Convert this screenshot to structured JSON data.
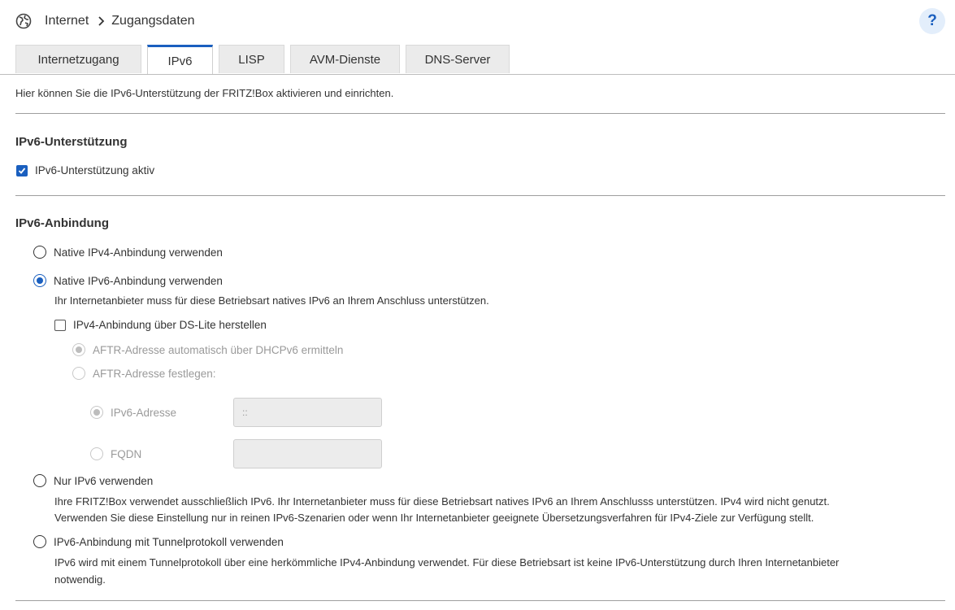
{
  "breadcrumb": {
    "section": "Internet",
    "page": "Zugangsdaten"
  },
  "help": {
    "label": "?"
  },
  "tabs": [
    {
      "label": "Internetzugang"
    },
    {
      "label": "IPv6"
    },
    {
      "label": "LISP"
    },
    {
      "label": "AVM-Dienste"
    },
    {
      "label": "DNS-Server"
    }
  ],
  "active_tab": "IPv6",
  "description": "Hier können Sie die IPv6-Unterstützung der FRITZ!Box aktivieren und einrichten.",
  "support": {
    "heading": "IPv6-Unterstützung",
    "checkbox_label": "IPv6-Unterstützung aktiv",
    "checked": true
  },
  "binding": {
    "heading": "IPv6-Anbindung",
    "options": [
      {
        "label": "Native IPv4-Anbindung verwenden",
        "selected": false
      },
      {
        "label": "Native IPv6-Anbindung verwenden",
        "selected": true,
        "hint": "Ihr Internetanbieter muss für diese Betriebsart natives IPv6 an Ihrem Anschluss unterstützen."
      },
      {
        "label": "Nur IPv6 verwenden",
        "selected": false,
        "hint1": "Ihre FRITZ!Box verwendet ausschließlich IPv6. Ihr Internetanbieter muss für diese Betriebsart natives IPv6 an Ihrem Anschlusss unterstützen. IPv4 wird nicht genutzt.",
        "hint2": "Verwenden Sie diese Einstellung nur in reinen IPv6-Szenarien oder wenn Ihr Internetanbieter geeignete Übersetzungsverfahren für IPv4-Ziele zur Verfügung stellt."
      },
      {
        "label": "IPv6-Anbindung mit Tunnelprotokoll verwenden",
        "selected": false,
        "hint1": "IPv6 wird mit einem Tunnelprotokoll über eine herkömmliche IPv4-Anbindung verwendet. Für diese Betriebsart ist keine IPv6-Unterstützung durch Ihren Internetanbieter",
        "hint2": "notwendig."
      }
    ],
    "dslite": {
      "label": "IPv4-Anbindung über DS-Lite herstellen",
      "checked": false,
      "aftr_auto": "AFTR-Adresse automatisch über DHCPv6 ermitteln",
      "aftr_manual": "AFTR-Adresse festlegen:",
      "ipv6_label": "IPv6-Adresse",
      "ipv6_value": "::",
      "fqdn_label": "FQDN",
      "fqdn_value": ""
    }
  },
  "colors": {
    "accent": "#1a5fbf",
    "disabled_text": "#9a9a9a",
    "input_bg": "#ececec"
  }
}
